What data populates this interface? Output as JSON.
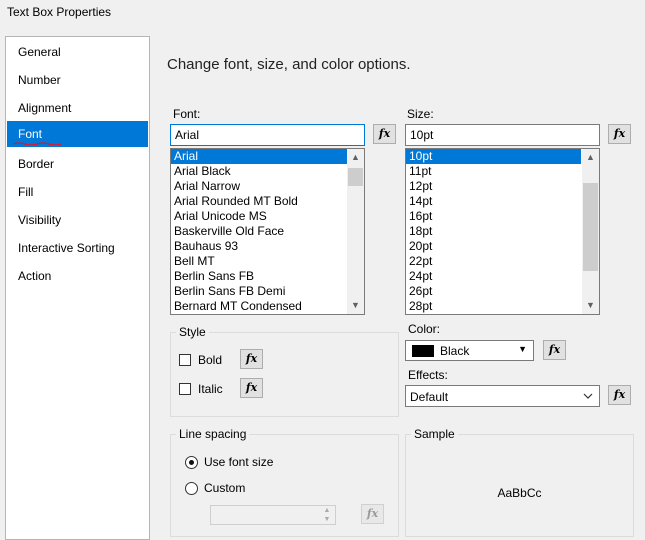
{
  "window": {
    "title": "Text Box Properties"
  },
  "nav": {
    "items": [
      {
        "label": "General"
      },
      {
        "label": "Number"
      },
      {
        "label": "Alignment"
      },
      {
        "label": "Font"
      },
      {
        "label": "Border"
      },
      {
        "label": "Fill"
      },
      {
        "label": "Visibility"
      },
      {
        "label": "Interactive Sorting"
      },
      {
        "label": "Action"
      }
    ],
    "selected": "Font"
  },
  "main": {
    "heading": "Change font, size, and color options.",
    "font": {
      "label": "Font:",
      "value": "Arial",
      "options": [
        "Arial",
        "Arial Black",
        "Arial Narrow",
        "Arial Rounded MT Bold",
        "Arial Unicode MS",
        "Baskerville Old Face",
        "Bauhaus 93",
        "Bell MT",
        "Berlin Sans FB",
        "Berlin Sans FB Demi",
        "Bernard MT Condensed"
      ],
      "selected": "Arial"
    },
    "size": {
      "label": "Size:",
      "value": "10pt",
      "options": [
        "10pt",
        "11pt",
        "12pt",
        "14pt",
        "16pt",
        "18pt",
        "20pt",
        "22pt",
        "24pt",
        "26pt",
        "28pt"
      ],
      "selected": "10pt"
    },
    "fx_label": "fx",
    "style": {
      "title": "Style",
      "bold_label": "Bold",
      "italic_label": "Italic",
      "bold_checked": false,
      "italic_checked": false
    },
    "color": {
      "label": "Color:",
      "value": "Black",
      "swatch": "#000000"
    },
    "effects": {
      "label": "Effects:",
      "value": "Default"
    },
    "line_spacing": {
      "title": "Line spacing",
      "use_font_size_label": "Use font size",
      "custom_label": "Custom",
      "selected": "Use font size",
      "custom_value": ""
    },
    "sample": {
      "title": "Sample",
      "text": "AaBbCc"
    }
  },
  "colors": {
    "accent": "#0078d7",
    "squiggle": "#e81123"
  }
}
